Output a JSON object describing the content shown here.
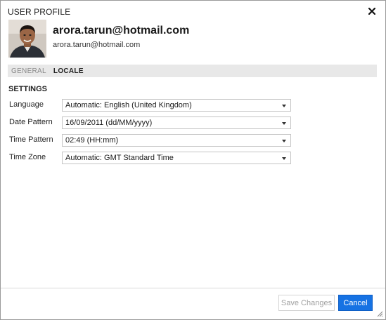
{
  "dialog": {
    "title": "USER PROFILE",
    "close_icon": "close-icon"
  },
  "profile": {
    "display_name": "arora.tarun@hotmail.com",
    "email": "arora.tarun@hotmail.com",
    "avatar_icon": "user-photo"
  },
  "tabs": [
    {
      "label": "GENERAL",
      "active": false
    },
    {
      "label": "LOCALE",
      "active": true
    }
  ],
  "settings": {
    "title": "SETTINGS",
    "fields": [
      {
        "label": "Language",
        "value": "Automatic: English (United Kingdom)"
      },
      {
        "label": "Date Pattern",
        "value": "16/09/2011 (dd/MM/yyyy)"
      },
      {
        "label": "Time Pattern",
        "value": "02:49 (HH:mm)"
      },
      {
        "label": "Time Zone",
        "value": "Automatic: GMT Standard Time"
      }
    ]
  },
  "footer": {
    "save_label": "Save Changes",
    "cancel_label": "Cancel"
  },
  "colors": {
    "accent": "#1672e3",
    "tabbar_bg": "#e8e8e8",
    "disabled_text": "#a0a0a0"
  }
}
